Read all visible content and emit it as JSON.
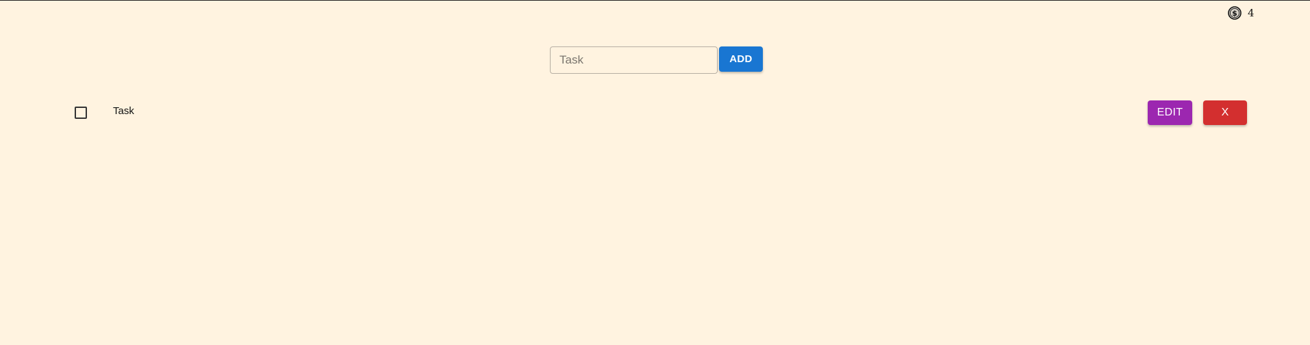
{
  "coins": {
    "icon": "dollar-coin-icon",
    "count": "4"
  },
  "add_task": {
    "input_value": "",
    "placeholder": "Task",
    "add_label": "ADD"
  },
  "tasks": [
    {
      "label": "Task",
      "checked": false,
      "edit_label": "EDIT",
      "delete_label": "X"
    }
  ],
  "colors": {
    "background": "#fff3e0",
    "add_button": "#1976d2",
    "edit_button": "#9c27b0",
    "delete_button": "#d32f2f"
  }
}
